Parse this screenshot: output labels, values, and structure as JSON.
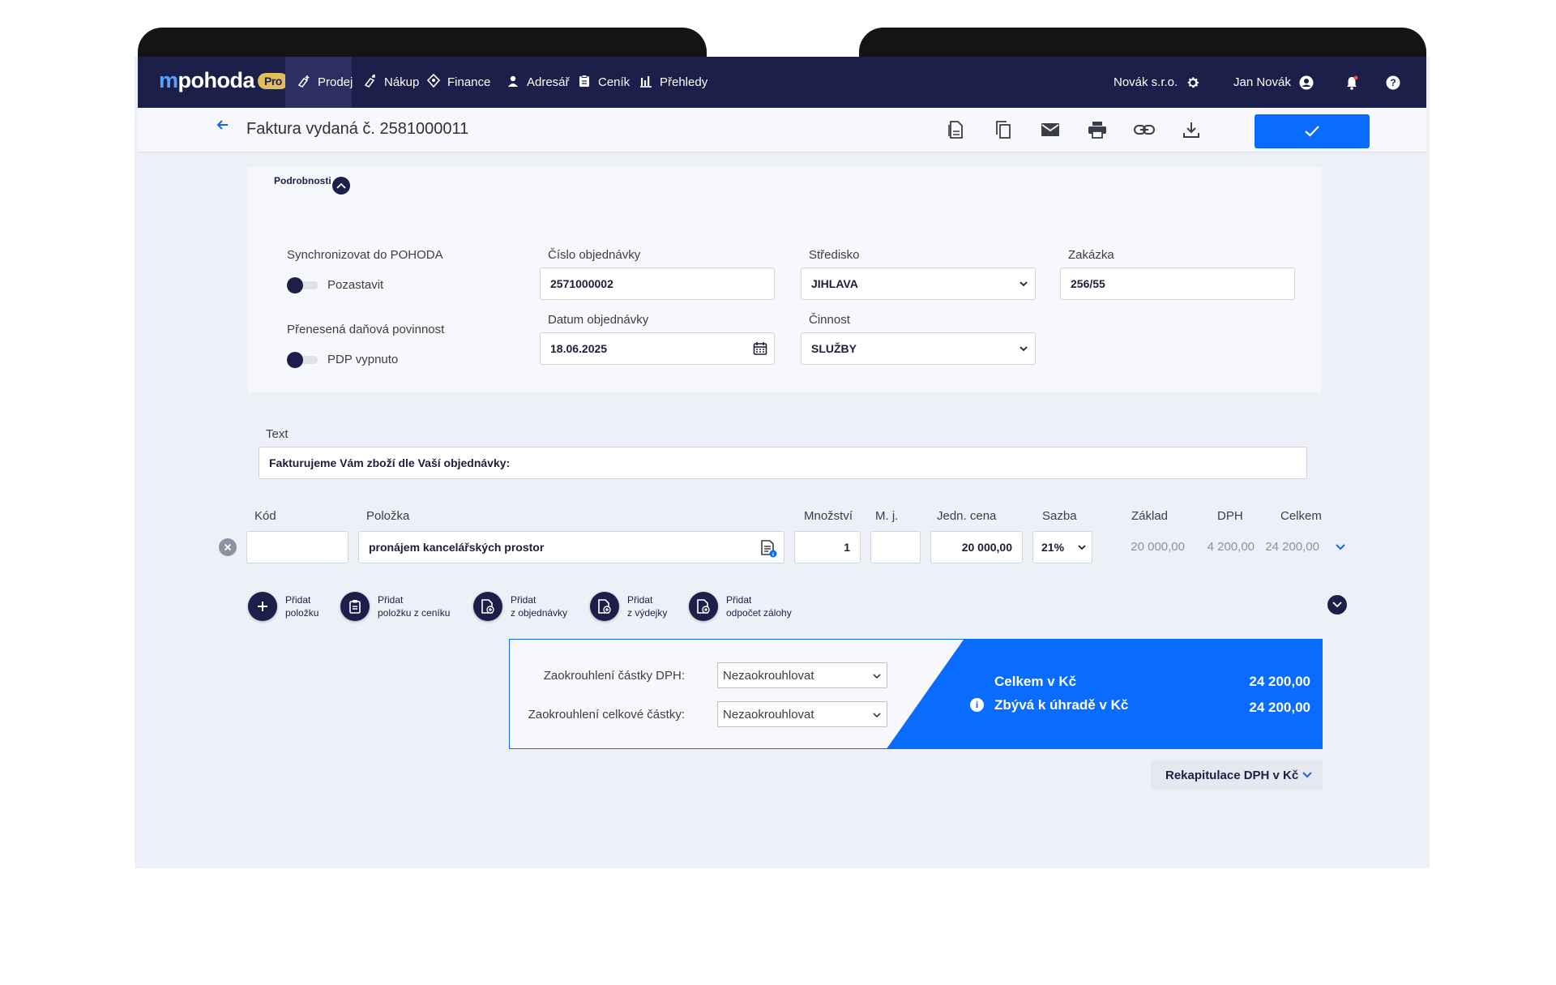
{
  "app": {
    "logo_text": "pohoda",
    "logo_mark": "m",
    "edition_badge": "Pro"
  },
  "nav": {
    "items": [
      {
        "label": "Prodej",
        "icon": "sale-icon"
      },
      {
        "label": "Nákup",
        "icon": "purchase-icon"
      },
      {
        "label": "Finance",
        "icon": "finance-icon"
      },
      {
        "label": "Adresář",
        "icon": "person-icon"
      },
      {
        "label": "Ceník",
        "icon": "pricelist-icon"
      },
      {
        "label": "Přehledy",
        "icon": "chart-icon"
      }
    ],
    "active": "Prodej",
    "company": "Novák s.r.o.",
    "user": "Jan Novák"
  },
  "titlebar": {
    "title": "Faktura vydaná č. 2581000011",
    "tools": [
      "pdf-icon",
      "copy-icon",
      "mail-icon",
      "print-icon",
      "link-icon",
      "download-icon"
    ]
  },
  "details": {
    "heading": "Podrobnosti",
    "sync_label": "Synchronizovat do POHODA",
    "sync_toggle_text": "Pozastavit",
    "pdp_label": "Přenesená daňová povinnost",
    "pdp_toggle_text": "PDP vypnuto",
    "order_number_label": "Číslo objednávky",
    "order_number_value": "2571000002",
    "order_date_label": "Datum objednávky",
    "order_date_value": "18.06.2025",
    "centre_label": "Středisko",
    "centre_value": "JIHLAVA",
    "activity_label": "Činnost",
    "activity_value": "SLUŽBY",
    "contract_label": "Zakázka",
    "contract_value": "256/55"
  },
  "text_section": {
    "label": "Text",
    "value": "Fakturujeme Vám zboží dle Vaší objednávky:"
  },
  "items_table": {
    "headers": {
      "code": "Kód",
      "item": "Položka",
      "quantity": "Množství",
      "unit": "M. j.",
      "unit_price": "Jedn. cena",
      "rate": "Sazba",
      "base": "Základ",
      "vat": "DPH",
      "total": "Celkem"
    },
    "rows": [
      {
        "code": "",
        "item": "pronájem kancelářských prostor",
        "quantity": "1",
        "unit": "",
        "unit_price": "20 000,00",
        "rate": "21%",
        "base": "20 000,00",
        "vat": "4 200,00",
        "total": "24 200,00"
      }
    ]
  },
  "add_buttons": [
    {
      "line1": "Přidat",
      "line2": "položku"
    },
    {
      "line1": "Přidat",
      "line2": "položku z ceníku"
    },
    {
      "line1": "Přidat",
      "line2": "z objednávky"
    },
    {
      "line1": "Přidat",
      "line2": "z výdejky"
    },
    {
      "line1": "Přidat",
      "line2": "odpočet zálohy"
    }
  ],
  "totals": {
    "vat_rounding_label": "Zaokrouhlení částky DPH:",
    "vat_rounding_value": "Nezaokrouhlovat",
    "total_rounding_label": "Zaokrouhlení celkové částky:",
    "total_rounding_value": "Nezaokrouhlovat",
    "total_label": "Celkem v Kč",
    "total_value": "24 200,00",
    "remaining_label": "Zbývá k úhradě v Kč",
    "remaining_value": "24 200,00"
  },
  "recap": {
    "label": "Rekapitulace DPH v Kč"
  },
  "colors": {
    "navy": "#1b1f49",
    "accent_blue": "#0a6bff",
    "background": "#eef0f7"
  }
}
